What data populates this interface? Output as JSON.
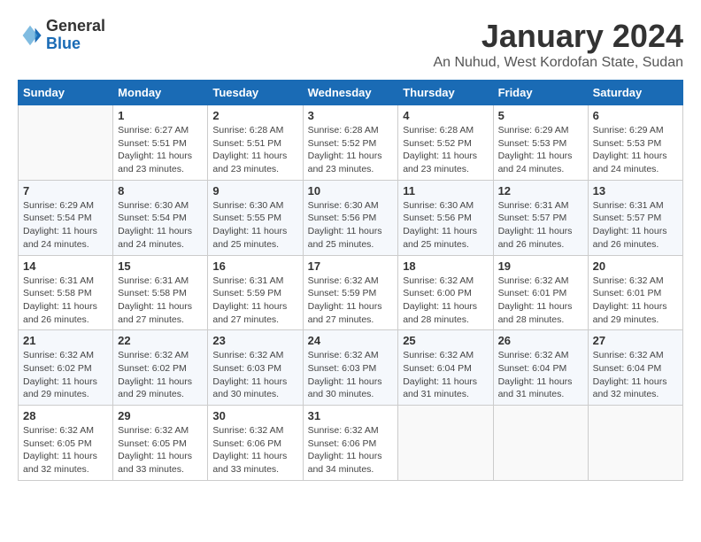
{
  "logo": {
    "line1": "General",
    "line2": "Blue"
  },
  "title": "January 2024",
  "subtitle": "An Nuhud, West Kordofan State, Sudan",
  "days_of_week": [
    "Sunday",
    "Monday",
    "Tuesday",
    "Wednesday",
    "Thursday",
    "Friday",
    "Saturday"
  ],
  "weeks": [
    [
      {
        "day": "",
        "info": ""
      },
      {
        "day": "1",
        "info": "Sunrise: 6:27 AM\nSunset: 5:51 PM\nDaylight: 11 hours\nand 23 minutes."
      },
      {
        "day": "2",
        "info": "Sunrise: 6:28 AM\nSunset: 5:51 PM\nDaylight: 11 hours\nand 23 minutes."
      },
      {
        "day": "3",
        "info": "Sunrise: 6:28 AM\nSunset: 5:52 PM\nDaylight: 11 hours\nand 23 minutes."
      },
      {
        "day": "4",
        "info": "Sunrise: 6:28 AM\nSunset: 5:52 PM\nDaylight: 11 hours\nand 23 minutes."
      },
      {
        "day": "5",
        "info": "Sunrise: 6:29 AM\nSunset: 5:53 PM\nDaylight: 11 hours\nand 24 minutes."
      },
      {
        "day": "6",
        "info": "Sunrise: 6:29 AM\nSunset: 5:53 PM\nDaylight: 11 hours\nand 24 minutes."
      }
    ],
    [
      {
        "day": "7",
        "info": "Sunrise: 6:29 AM\nSunset: 5:54 PM\nDaylight: 11 hours\nand 24 minutes."
      },
      {
        "day": "8",
        "info": "Sunrise: 6:30 AM\nSunset: 5:54 PM\nDaylight: 11 hours\nand 24 minutes."
      },
      {
        "day": "9",
        "info": "Sunrise: 6:30 AM\nSunset: 5:55 PM\nDaylight: 11 hours\nand 25 minutes."
      },
      {
        "day": "10",
        "info": "Sunrise: 6:30 AM\nSunset: 5:56 PM\nDaylight: 11 hours\nand 25 minutes."
      },
      {
        "day": "11",
        "info": "Sunrise: 6:30 AM\nSunset: 5:56 PM\nDaylight: 11 hours\nand 25 minutes."
      },
      {
        "day": "12",
        "info": "Sunrise: 6:31 AM\nSunset: 5:57 PM\nDaylight: 11 hours\nand 26 minutes."
      },
      {
        "day": "13",
        "info": "Sunrise: 6:31 AM\nSunset: 5:57 PM\nDaylight: 11 hours\nand 26 minutes."
      }
    ],
    [
      {
        "day": "14",
        "info": "Sunrise: 6:31 AM\nSunset: 5:58 PM\nDaylight: 11 hours\nand 26 minutes."
      },
      {
        "day": "15",
        "info": "Sunrise: 6:31 AM\nSunset: 5:58 PM\nDaylight: 11 hours\nand 27 minutes."
      },
      {
        "day": "16",
        "info": "Sunrise: 6:31 AM\nSunset: 5:59 PM\nDaylight: 11 hours\nand 27 minutes."
      },
      {
        "day": "17",
        "info": "Sunrise: 6:32 AM\nSunset: 5:59 PM\nDaylight: 11 hours\nand 27 minutes."
      },
      {
        "day": "18",
        "info": "Sunrise: 6:32 AM\nSunset: 6:00 PM\nDaylight: 11 hours\nand 28 minutes."
      },
      {
        "day": "19",
        "info": "Sunrise: 6:32 AM\nSunset: 6:01 PM\nDaylight: 11 hours\nand 28 minutes."
      },
      {
        "day": "20",
        "info": "Sunrise: 6:32 AM\nSunset: 6:01 PM\nDaylight: 11 hours\nand 29 minutes."
      }
    ],
    [
      {
        "day": "21",
        "info": "Sunrise: 6:32 AM\nSunset: 6:02 PM\nDaylight: 11 hours\nand 29 minutes."
      },
      {
        "day": "22",
        "info": "Sunrise: 6:32 AM\nSunset: 6:02 PM\nDaylight: 11 hours\nand 29 minutes."
      },
      {
        "day": "23",
        "info": "Sunrise: 6:32 AM\nSunset: 6:03 PM\nDaylight: 11 hours\nand 30 minutes."
      },
      {
        "day": "24",
        "info": "Sunrise: 6:32 AM\nSunset: 6:03 PM\nDaylight: 11 hours\nand 30 minutes."
      },
      {
        "day": "25",
        "info": "Sunrise: 6:32 AM\nSunset: 6:04 PM\nDaylight: 11 hours\nand 31 minutes."
      },
      {
        "day": "26",
        "info": "Sunrise: 6:32 AM\nSunset: 6:04 PM\nDaylight: 11 hours\nand 31 minutes."
      },
      {
        "day": "27",
        "info": "Sunrise: 6:32 AM\nSunset: 6:04 PM\nDaylight: 11 hours\nand 32 minutes."
      }
    ],
    [
      {
        "day": "28",
        "info": "Sunrise: 6:32 AM\nSunset: 6:05 PM\nDaylight: 11 hours\nand 32 minutes."
      },
      {
        "day": "29",
        "info": "Sunrise: 6:32 AM\nSunset: 6:05 PM\nDaylight: 11 hours\nand 33 minutes."
      },
      {
        "day": "30",
        "info": "Sunrise: 6:32 AM\nSunset: 6:06 PM\nDaylight: 11 hours\nand 33 minutes."
      },
      {
        "day": "31",
        "info": "Sunrise: 6:32 AM\nSunset: 6:06 PM\nDaylight: 11 hours\nand 34 minutes."
      },
      {
        "day": "",
        "info": ""
      },
      {
        "day": "",
        "info": ""
      },
      {
        "day": "",
        "info": ""
      }
    ]
  ]
}
